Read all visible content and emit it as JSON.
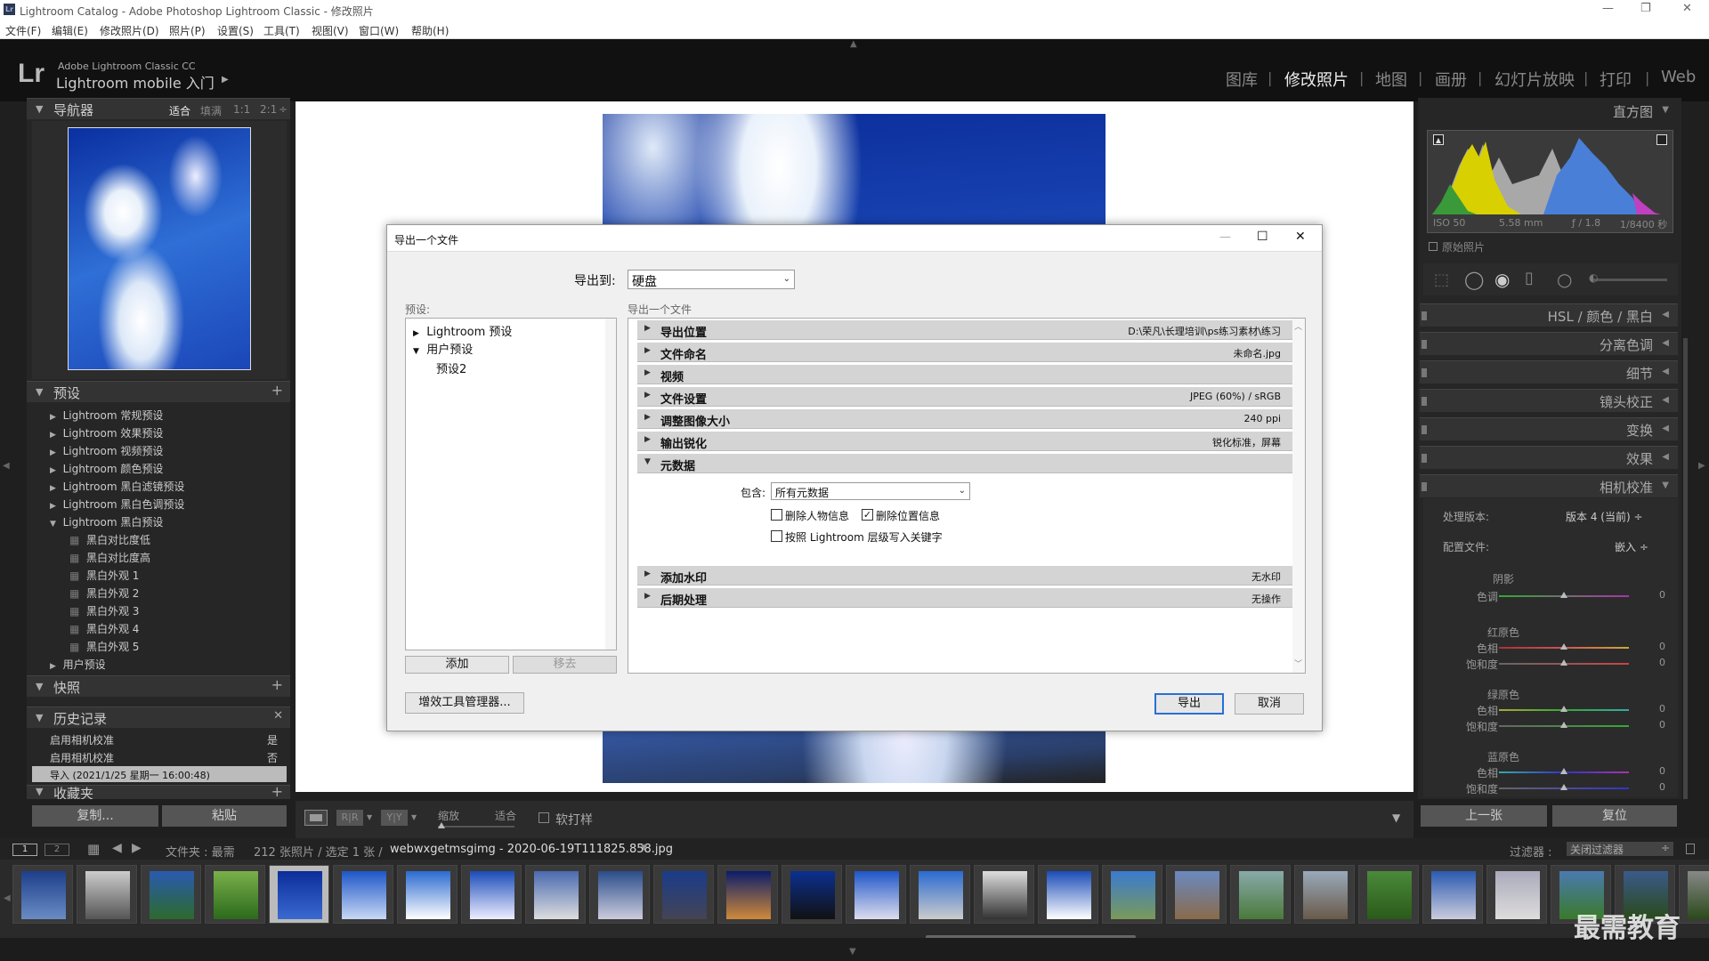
{
  "window": {
    "title": "Lightroom Catalog - Adobe Photoshop Lightroom Classic - 修改照片"
  },
  "menu": [
    "文件(F)",
    "编辑(E)",
    "修改照片(D)",
    "照片(P)",
    "设置(S)",
    "工具(T)",
    "视图(V)",
    "窗口(W)",
    "帮助(H)"
  ],
  "brand": {
    "logo": "Lr",
    "line1": "Adobe Lightroom Classic CC",
    "line2": "Lightroom mobile 入门"
  },
  "modules": [
    "图库",
    "修改照片",
    "地图",
    "画册",
    "幻灯片放映",
    "打印",
    "Web"
  ],
  "active_module": "修改照片",
  "navigator": {
    "title": "导航器",
    "opts": [
      "适合",
      "填满",
      "1:1",
      "2:1"
    ]
  },
  "presets": {
    "title": "预设",
    "groups": [
      "Lightroom 常规预设",
      "Lightroom 效果预设",
      "Lightroom 视频预设",
      "Lightroom 颜色预设",
      "Lightroom 黑白滤镜预设",
      "Lightroom 黑白色调预设",
      "Lightroom 黑白预设"
    ],
    "bw_items": [
      "黑白对比度低",
      "黑白对比度高",
      "黑白外观 1",
      "黑白外观 2",
      "黑白外观 3",
      "黑白外观 4",
      "黑白外观 5"
    ],
    "user": "用户预设"
  },
  "snapshots": {
    "title": "快照"
  },
  "history": {
    "title": "历史记录",
    "items": [
      {
        "label": "启用相机校准",
        "value": "是"
      },
      {
        "label": "启用相机校准",
        "value": "否"
      },
      {
        "label": "导入 (2021/1/25 星期一 16:00:48)",
        "value": ""
      }
    ]
  },
  "collections": {
    "title": "收藏夹"
  },
  "left_buttons": {
    "copy": "复制...",
    "paste": "粘贴"
  },
  "toolbar": {
    "zoom": "缩放",
    "fit": "适合",
    "soft_proof": "软打样"
  },
  "dialog": {
    "title": "导出一个文件",
    "export_to_label": "导出到:",
    "export_to_value": "硬盘",
    "presets_label": "预设:",
    "preset_tree": [
      {
        "label": "Lightroom 预设",
        "arrow": "▶"
      },
      {
        "label": "用户预设",
        "arrow": "▼"
      },
      {
        "label": "预设2",
        "arrow": ""
      }
    ],
    "add": "添加",
    "remove": "移去",
    "right_label": "导出一个文件",
    "sections": [
      {
        "name": "导出位置",
        "value": "D:\\荣凡\\长理培训\\ps练习素材\\练习"
      },
      {
        "name": "文件命名",
        "value": "未命名.jpg"
      },
      {
        "name": "视频",
        "value": ""
      },
      {
        "name": "文件设置",
        "value": "JPEG (60%) / sRGB"
      },
      {
        "name": "调整图像大小",
        "value": "240 ppi"
      },
      {
        "name": "输出锐化",
        "value": "锐化标准，屏幕"
      },
      {
        "name": "元数据",
        "value": ""
      }
    ],
    "metadata": {
      "include_label": "包含:",
      "include_value": "所有元数据",
      "cb1": "删除人物信息",
      "cb2": "删除位置信息",
      "cb3": "按照 Lightroom 层级写入关键字"
    },
    "sections2": [
      {
        "name": "添加水印",
        "value": "无水印"
      },
      {
        "name": "后期处理",
        "value": "无操作"
      }
    ],
    "plugin_btn": "增效工具管理器...",
    "export_btn": "导出",
    "cancel_btn": "取消"
  },
  "histogram": {
    "title": "直方图",
    "iso": "ISO 50",
    "focal": "5.58 mm",
    "aperture": "ƒ / 1.8",
    "shutter": "1/8400 秒",
    "orig": "原始照片"
  },
  "right_sections": [
    {
      "label": "HSL / 颜色 / 黑白"
    },
    {
      "label": "分离色调"
    },
    {
      "label": "细节"
    },
    {
      "label": "镜头校正"
    },
    {
      "label": "变换"
    },
    {
      "label": "效果"
    },
    {
      "label": "相机校准"
    }
  ],
  "calibration": {
    "process_label": "处理版本:",
    "process_value": "版本 4 (当前) ÷",
    "profile_label": "配置文件:",
    "profile_value": "嵌入 ÷",
    "shadow_title": "阴影",
    "tint": "色调",
    "red_title": "红原色",
    "green_title": "绿原色",
    "blue_title": "蓝原色",
    "hue": "色相",
    "sat": "饱和度",
    "zero": "0"
  },
  "right_buttons": {
    "prev": "上一张",
    "reset": "复位"
  },
  "filmstrip": {
    "pages": [
      "1",
      "2"
    ],
    "folder": "文件夹 : 最需",
    "count": "212 张照片 / 选定 1 张 /",
    "filename": "webwxgetmsgimg - 2020-06-19T111825.858.jpg",
    "filter_label": "过滤器 :",
    "filter_value": "关闭过滤器"
  },
  "watermark": "最需教育",
  "colors": {
    "accent_blue": "#2f6fd6",
    "panel": "#262626",
    "header": "#111111"
  }
}
